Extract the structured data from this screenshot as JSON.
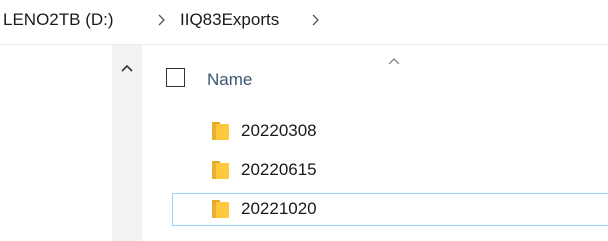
{
  "breadcrumb": {
    "drive": "LENO2TB (D:)",
    "folder": "IIQ83Exports",
    "separator_icon": "chevron-right-icon"
  },
  "nav_pane": {
    "scroll_up_icon": "chevron-up-icon"
  },
  "header": {
    "name_label": "Name",
    "sort_icon": "sort-ascending-caret-icon",
    "select_all_checked": false
  },
  "files": [
    {
      "name": "20220308",
      "type": "folder",
      "icon": "folder-icon"
    },
    {
      "name": "20220615",
      "type": "folder",
      "icon": "folder-icon"
    },
    {
      "name": "20221020",
      "type": "folder",
      "icon": "folder-icon",
      "focused": true
    }
  ],
  "colors": {
    "folder": "#ffc83d",
    "folder_shadow": "#e0a820",
    "header_text": "#3a5573",
    "focus_outline": "#99d1ff",
    "nav_background": "#f2f2f2"
  }
}
